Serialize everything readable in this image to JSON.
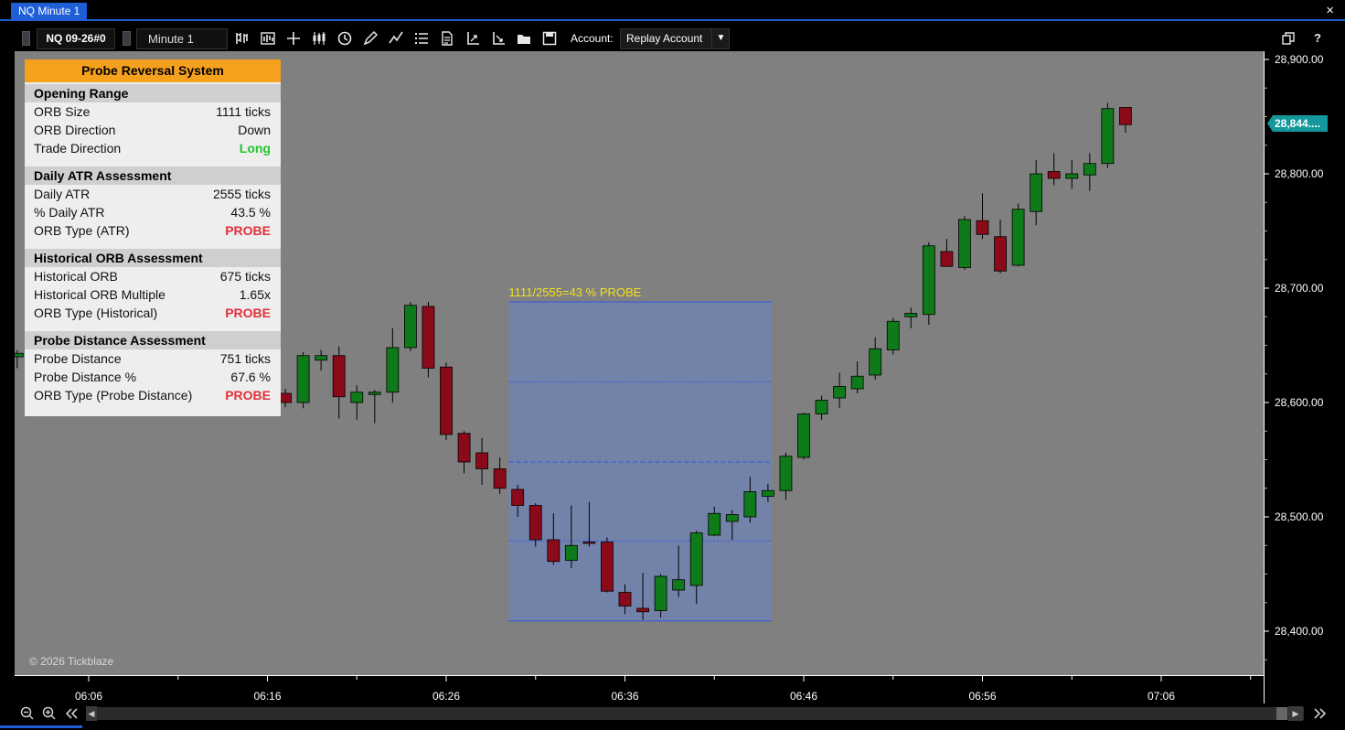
{
  "window": {
    "title": "NQ Minute 1",
    "close": "×"
  },
  "toolbar": {
    "symbol": "NQ 09-26#0",
    "interval": "Minute 1",
    "account_label": "Account:",
    "account_value": "Replay Account",
    "icons": [
      "bar-type-icon",
      "chart-style-icon",
      "crosshair-icon",
      "candlestick-icon",
      "clock-icon",
      "pencil-icon",
      "drawing-icon",
      "list-icon",
      "document-icon",
      "axis-up-icon",
      "axis-down-icon",
      "folder-icon",
      "save-icon",
      "copy-icon",
      "help-icon"
    ]
  },
  "panel": {
    "title": "Probe Reversal System",
    "sections": [
      {
        "heading": "Opening Range",
        "rows": [
          {
            "label": "ORB Size",
            "value": "1111 ticks"
          },
          {
            "label": "ORB Direction",
            "value": "Down"
          },
          {
            "label": "Trade Direction",
            "value": "Long"
          }
        ]
      },
      {
        "heading": "Daily ATR Assessment",
        "rows": [
          {
            "label": "Daily ATR",
            "value": "2555 ticks"
          },
          {
            "label": "% Daily ATR",
            "value": "43.5 %"
          },
          {
            "label": "ORB Type (ATR)",
            "value": "PROBE"
          }
        ]
      },
      {
        "heading": "Historical ORB Assessment",
        "rows": [
          {
            "label": "Historical ORB",
            "value": "675 ticks"
          },
          {
            "label": "Historical ORB Multiple",
            "value": "1.65x"
          },
          {
            "label": "ORB Type (Historical)",
            "value": "PROBE"
          }
        ]
      },
      {
        "heading": "Probe Distance Assessment",
        "rows": [
          {
            "label": "Probe Distance",
            "value": "751 ticks"
          },
          {
            "label": "Probe Distance %",
            "value": "67.6 %"
          },
          {
            "label": "ORB Type (Probe Distance)",
            "value": "PROBE"
          }
        ]
      }
    ]
  },
  "colors": {
    "bull": "#0f7a1a",
    "bear": "#8a0a1a",
    "box": "#7382a8",
    "box_border": "#2f56e0",
    "orb_label": "#f2e020",
    "price_tag": "#14989c",
    "panel_accent": "#f6a11e",
    "long": "#24c52a",
    "probe": "#e0303b"
  },
  "chart": {
    "watermark": "© 2026 Tickblaze",
    "orb_label": "1111/2555=43 % PROBE",
    "price_tag": "28,844....",
    "ylim": [
      28360,
      28920
    ],
    "y_ticks": [
      "28,900.00",
      "28,800.00",
      "28,700.00",
      "28,600.00",
      "28,500.00",
      "28,400.00"
    ],
    "y_tick_values": [
      28900,
      28800,
      28700,
      28600,
      28500,
      28400
    ],
    "x_ticks": [
      "06:06",
      "06:16",
      "06:26",
      "06:36",
      "06:46",
      "06:56",
      "07:06"
    ],
    "x_tick_minute": [
      6,
      16,
      26,
      36,
      46,
      56,
      66
    ],
    "box": {
      "start_minute": 29.5,
      "end_minute": 44.2,
      "high": 28688,
      "low": 28409,
      "inner_lines": [
        28618,
        28548,
        28479
      ]
    },
    "price_tag_value": 28844
  },
  "chart_data": {
    "type": "candlestick",
    "x_start_minute": 2,
    "candles": [
      [
        28640,
        28646,
        28630,
        28643
      ],
      [
        28642,
        28648,
        28633,
        28637
      ],
      [
        28636,
        28639,
        28630,
        28634
      ],
      [
        28633,
        28636,
        28627,
        28631
      ],
      [
        28631,
        28635,
        28624,
        28628
      ],
      [
        28628,
        28632,
        28622,
        28626
      ],
      [
        28626,
        28631,
        28621,
        28628
      ],
      [
        28627,
        28634,
        28620,
        28626
      ],
      [
        28622,
        28632,
        28617,
        28629
      ],
      [
        28629,
        28637,
        28624,
        28633
      ],
      [
        28632,
        28634,
        28612,
        28617
      ],
      [
        28617,
        28630,
        28614,
        28627
      ],
      [
        28627,
        28631,
        28615,
        28619
      ],
      [
        28620,
        28624,
        28611,
        28614
      ],
      [
        28614,
        28620,
        28605,
        28608
      ],
      [
        28608,
        28612,
        28596,
        28600
      ],
      [
        28600,
        28644,
        28595,
        28641
      ],
      [
        28637,
        28646,
        28628,
        28641
      ],
      [
        28641,
        28649,
        28586,
        28605
      ],
      [
        28600,
        28615,
        28585,
        28609
      ],
      [
        28607,
        28611,
        28582,
        28609
      ],
      [
        28609,
        28665,
        28600,
        28648
      ],
      [
        28648,
        28688,
        28645,
        28685
      ],
      [
        28684,
        28688,
        28622,
        28630
      ],
      [
        28631,
        28635,
        28567,
        28572
      ],
      [
        28573,
        28575,
        28538,
        28548
      ],
      [
        28556,
        28569,
        28528,
        28542
      ],
      [
        28542,
        28552,
        28520,
        28525
      ],
      [
        28524,
        28528,
        28500,
        28510
      ],
      [
        28510,
        28512,
        28474,
        28480
      ],
      [
        28480,
        28503,
        28458,
        28461
      ],
      [
        28462,
        28510,
        28455,
        28475
      ],
      [
        28478,
        28513,
        28474,
        28477
      ],
      [
        28478,
        28482,
        28434,
        28435
      ],
      [
        28434,
        28441,
        28415,
        28422
      ],
      [
        28420,
        28451,
        28410,
        28417
      ],
      [
        28418,
        28450,
        28412,
        28448
      ],
      [
        28436,
        28475,
        28430,
        28445
      ],
      [
        28440,
        28488,
        28424,
        28486
      ],
      [
        28484,
        28509,
        28483,
        28503
      ],
      [
        28496,
        28506,
        28480,
        28502
      ],
      [
        28500,
        28535,
        28495,
        28522
      ],
      [
        28518,
        28529,
        28513,
        28523
      ],
      [
        28523,
        28556,
        28515,
        28553
      ],
      [
        28552,
        28591,
        28550,
        28590
      ],
      [
        28590,
        28606,
        28585,
        28602
      ],
      [
        28604,
        28626,
        28595,
        28614
      ],
      [
        28612,
        28636,
        28608,
        28623
      ],
      [
        28624,
        28657,
        28620,
        28647
      ],
      [
        28646,
        28674,
        28642,
        28671
      ],
      [
        28675,
        28683,
        28665,
        28678
      ],
      [
        28677,
        28740,
        28668,
        28737
      ],
      [
        28732,
        28743,
        28719,
        28719
      ],
      [
        28718,
        28763,
        28716,
        28760
      ],
      [
        28759,
        28783,
        28743,
        28747
      ],
      [
        28745,
        28760,
        28713,
        28715
      ],
      [
        28720,
        28774,
        28719,
        28769
      ],
      [
        28767,
        28812,
        28755,
        28800
      ],
      [
        28802,
        28818,
        28790,
        28796
      ],
      [
        28796,
        28812,
        28787,
        28800
      ],
      [
        28799,
        28818,
        28785,
        28809
      ],
      [
        28809,
        28862,
        28805,
        28857
      ],
      [
        28858,
        28858,
        28836,
        28843
      ]
    ]
  }
}
